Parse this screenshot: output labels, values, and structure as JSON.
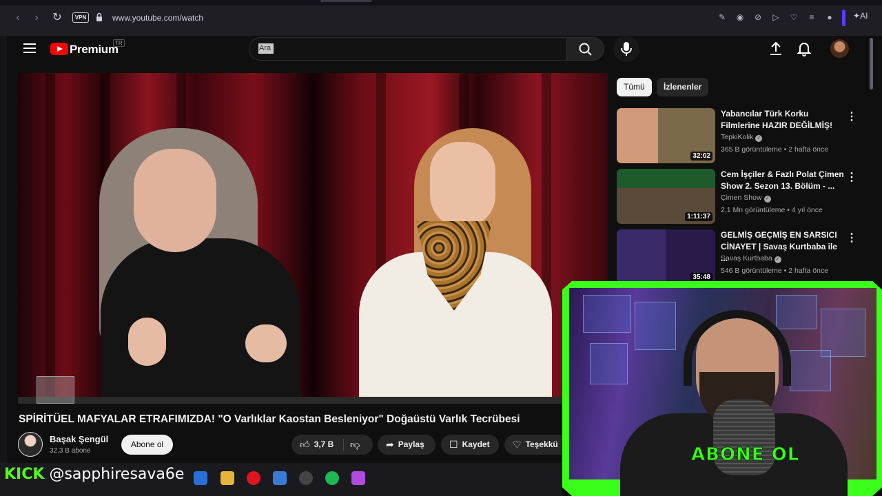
{
  "browser": {
    "url": "www.youtube.com/watch",
    "vpn_label": "VPN",
    "ai_label": "AI"
  },
  "header": {
    "brand": "Premium",
    "country_code": "TR",
    "search_placeholder": "Ara"
  },
  "video": {
    "title": "SPİRİTÜEL MAFYALAR ETRAFIMIZDA! \"O Varlıklar Kaostan Besleniyor\" Doğaüstü Varlık Tecrübesi",
    "channel_name": "Başak Şengül",
    "subscribers": "32,3 B abone",
    "subscribe_label": "Abone ol",
    "likes": "3,7 B",
    "share_label": "Paylaş",
    "save_label": "Kaydet",
    "thanks_label": "Teşekkü"
  },
  "sidebar": {
    "chips": [
      "Tümü",
      "İzlenenler"
    ],
    "recommendations": [
      {
        "title": "Yabancılar Türk Korku Filmlerine HAZIR DEĞİLMİŞ!",
        "channel": "TepkiKolik",
        "meta": "365 B görüntüleme • 2 hafta önce",
        "duration": "32:02"
      },
      {
        "title": "Cem İşçiler & Fazlı Polat Çimen Show 2. Sezon 13. Bölüm - ...",
        "channel": "Çimen Show",
        "meta": "2,1 Mn görüntüleme • 4 yıl önce",
        "duration": "1:11:37"
      },
      {
        "title": "GELMİŞ GEÇMİŞ EN SARSICI CİNAYET | Savaş Kurtbaba ile ...",
        "channel": "Savaş Kurtbaba",
        "meta": "546 B görüntüleme • 2 hafta önce",
        "duration": "35:48"
      }
    ]
  },
  "overlay": {
    "abone_ol": "ABONE OL",
    "kick_logo": "KICK",
    "kick_handle": "@sapphiresava6e"
  },
  "colors": {
    "youtube_red": "#ff0000",
    "overlay_green": "#39ff1a",
    "kick_green": "#53fc18",
    "background": "#0f0f0f"
  }
}
